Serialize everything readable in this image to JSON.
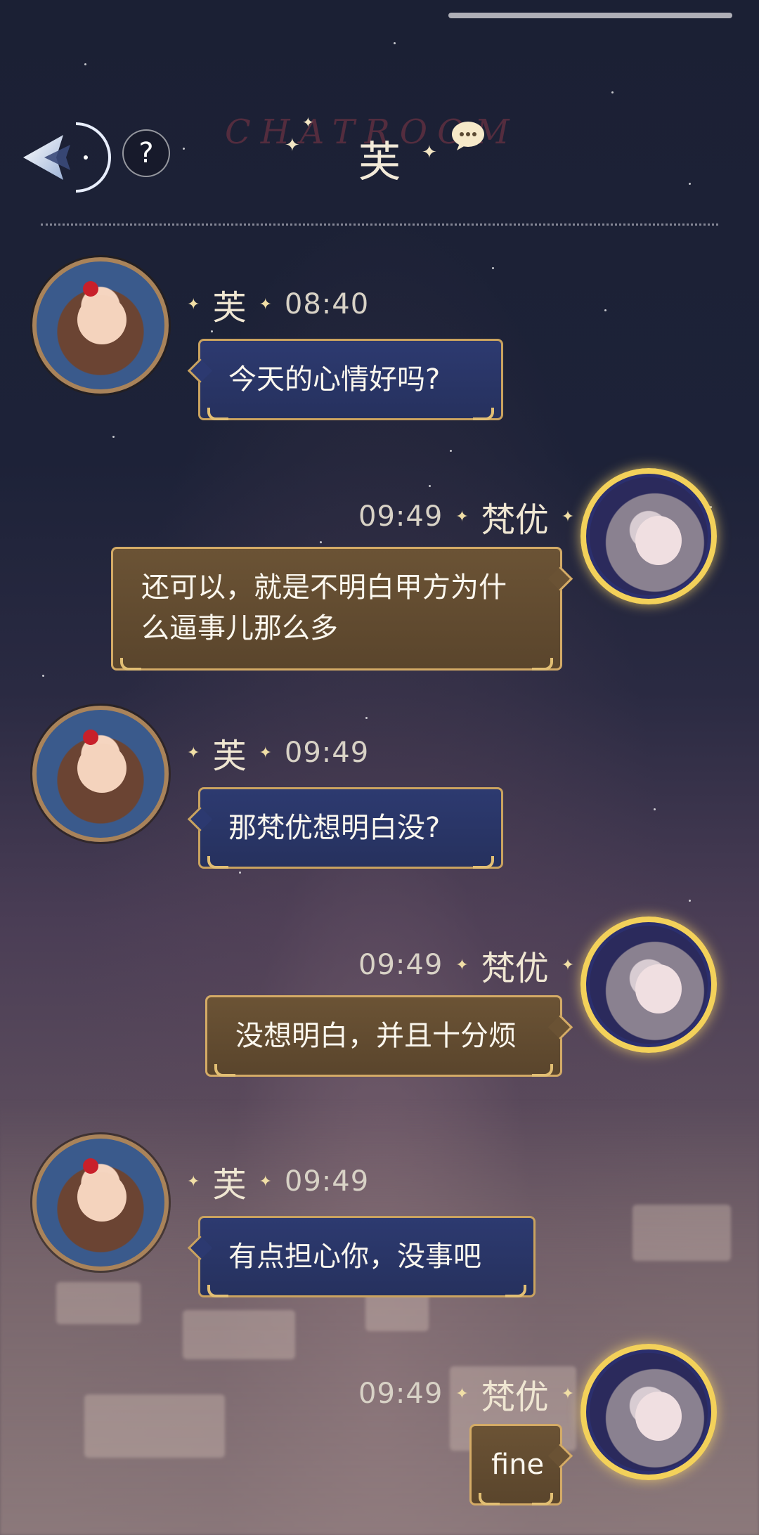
{
  "header": {
    "watermark": "CHATROOM",
    "title": "芙"
  },
  "messages": [
    {
      "sender": "芙",
      "time": "08:40",
      "side": "left",
      "text": "今天的心情好吗?"
    },
    {
      "sender": "梵优",
      "time": "09:49",
      "side": "right",
      "text": "还可以，就是不明白甲方为什么逼事儿那么多"
    },
    {
      "sender": "芙",
      "time": "09:49",
      "side": "left",
      "text": "那梵优想明白没?"
    },
    {
      "sender": "梵优",
      "time": "09:49",
      "side": "right",
      "text": "没想明白，并且十分烦"
    },
    {
      "sender": "芙",
      "time": "09:49",
      "side": "left",
      "text": "有点担心你，没事吧"
    },
    {
      "sender": "梵优",
      "time": "09:49",
      "side": "right",
      "text": "fine"
    }
  ],
  "icons": {
    "back": "back-arrow-icon",
    "help": "?",
    "chat": "chat-bubble-icon"
  },
  "colors": {
    "left_bubble": "#2d3a70",
    "right_bubble": "#6b5335",
    "gold_border": "#caa35f"
  }
}
